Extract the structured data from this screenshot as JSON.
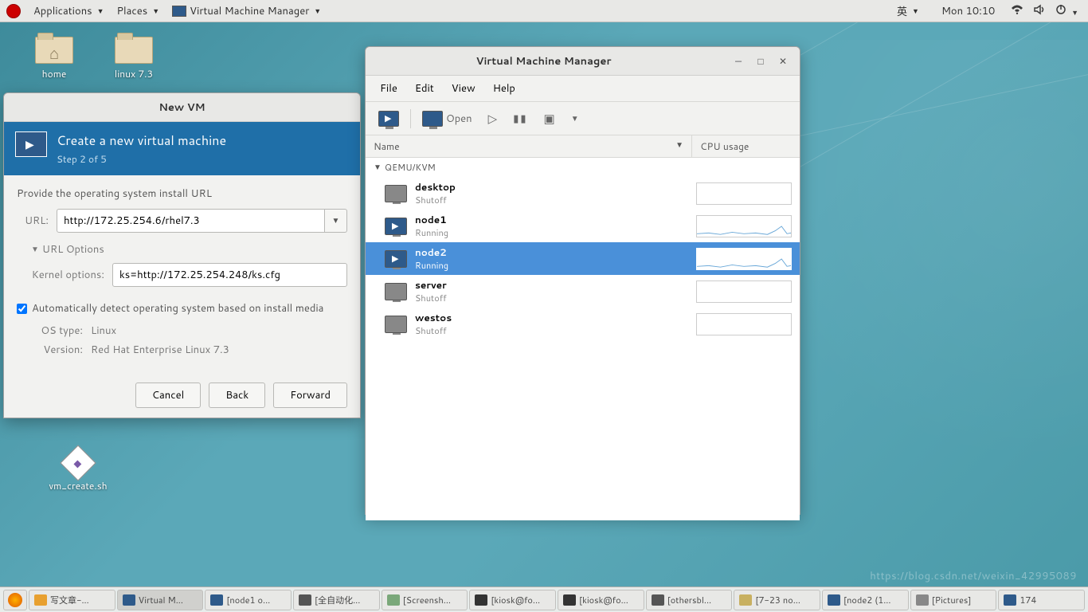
{
  "panel": {
    "applications": "Applications",
    "places": "Places",
    "app_title": "Virtual Machine Manager",
    "ime": "英",
    "clock": "Mon 10:10"
  },
  "desktop": {
    "home": "home",
    "folder2": "linux 7.3",
    "script": "vm_create.sh"
  },
  "newvm": {
    "title": "New VM",
    "heading": "Create a new virtual machine",
    "step": "Step 2 of 5",
    "prompt": "Provide the operating system install URL",
    "url_label": "URL:",
    "url_value": "http://172.25.254.6/rhel7.3",
    "url_options": "URL Options",
    "kernel_label": "Kernel options:",
    "kernel_value": "ks=http://172.25.254.248/ks.cfg",
    "autodetect": "Automatically detect operating system based on install media",
    "ostype_label": "OS type:",
    "ostype_value": "Linux",
    "version_label": "Version:",
    "version_value": "Red Hat Enterprise Linux 7.3",
    "cancel": "Cancel",
    "back": "Back",
    "forward": "Forward"
  },
  "vmm": {
    "title": "Virtual Machine Manager",
    "menu": {
      "file": "File",
      "edit": "Edit",
      "view": "View",
      "help": "Help"
    },
    "toolbar": {
      "open": "Open"
    },
    "cols": {
      "name": "Name",
      "cpu": "CPU usage"
    },
    "group": "QEMU/KVM",
    "vms": [
      {
        "name": "desktop",
        "status": "Shutoff",
        "running": false,
        "selected": false
      },
      {
        "name": "node1",
        "status": "Running",
        "running": true,
        "selected": false
      },
      {
        "name": "node2",
        "status": "Running",
        "running": true,
        "selected": true
      },
      {
        "name": "server",
        "status": "Shutoff",
        "running": false,
        "selected": false
      },
      {
        "name": "westos",
        "status": "Shutoff",
        "running": false,
        "selected": false
      }
    ]
  },
  "taskbar": {
    "items": [
      "写文章-...",
      "Virtual M...",
      "[node1 o...",
      "[全自动化...",
      "[Screensh...",
      "[kiosk@fo...",
      "[kiosk@fo...",
      "[othersbl...",
      "[7-23 no...",
      "[node2 (1...",
      "[Pictures]",
      "174"
    ]
  },
  "watermark": "https://blog.csdn.net/weixin_42995089"
}
